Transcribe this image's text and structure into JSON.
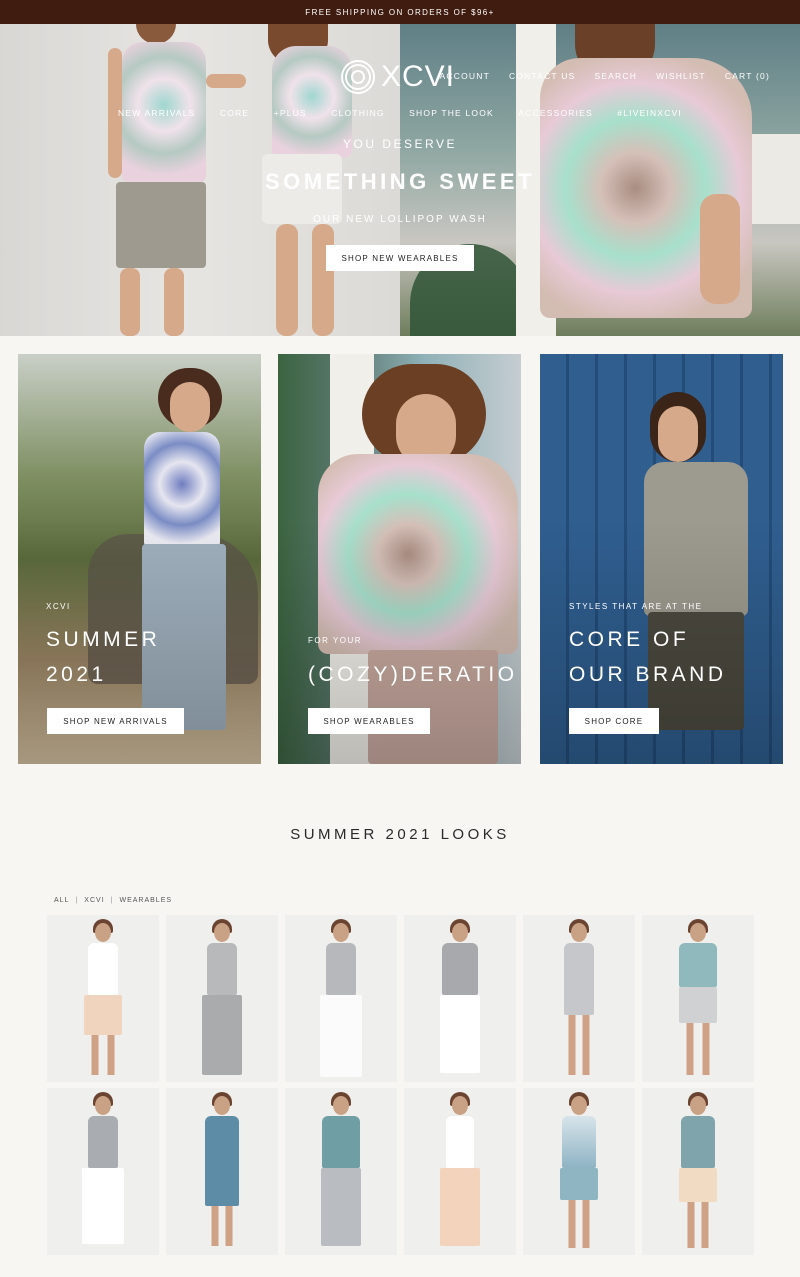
{
  "announcement": "FREE SHIPPING ON ORDERS OF $96+",
  "brand": {
    "logo_text": "XCVI"
  },
  "utility_nav": [
    "ACCOUNT",
    "CONTACT US",
    "SEARCH",
    "WISHLIST",
    "CART (0)"
  ],
  "main_nav": [
    "NEW ARRIVALS",
    "CORE",
    "+PLUS",
    "CLOTHING",
    "SHOP THE LOOK",
    "ACCESSORIES",
    "#LIVEINXCVI"
  ],
  "hero": {
    "pretitle": "YOU DESERVE",
    "title": "SOMETHING SWEET",
    "subtitle": "OUR NEW LOLLIPOP WASH",
    "button": "SHOP NEW WEARABLES",
    "slides_total": 5,
    "active_slide": 3
  },
  "promos": [
    {
      "pretitle": "XCVI",
      "title_line1": "SUMMER",
      "title_line2": "2021",
      "button": "SHOP NEW ARRIVALS"
    },
    {
      "pretitle": "FOR YOUR",
      "title_line1": "(COZY)DERATIO",
      "title_line2": "",
      "button": "SHOP WEARABLES"
    },
    {
      "pretitle": "STYLES THAT ARE AT THE",
      "title_line1": "CORE OF",
      "title_line2": "OUR BRAND",
      "button": "SHOP CORE"
    }
  ],
  "looks": {
    "title": "SUMMER 2021 LOOKS",
    "filters": [
      "ALL",
      "XCVI",
      "WEARABLES"
    ]
  }
}
